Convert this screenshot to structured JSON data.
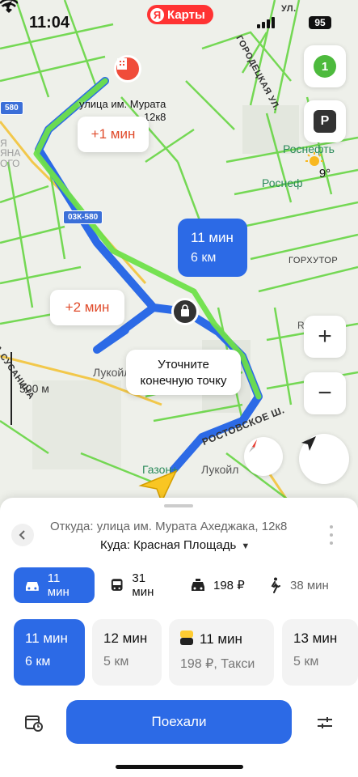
{
  "status": {
    "time": "11:04",
    "app_badge": "Карты",
    "brand_letter": "Я",
    "battery": "95"
  },
  "map": {
    "labels": {
      "street_top": "ГОРОДЕЦКАЯ УЛ.",
      "street_top2": "УЛ.",
      "rosneft1": "Роснефть",
      "rosneft2": "Роснеф",
      "gorkhutor": "ГОРХУТОР",
      "rostovskoe": "РОСТОВСКОЕ Ш.",
      "route_code": "03К-580",
      "lukoil1": "Лукойл",
      "lukoil2": "Лукойл",
      "gazon": "Газон+",
      "susanina": "А СУСАНИНА",
      "left_code": "580",
      "left_yana": "ЯНА",
      "left_ogo": "ОГО",
      "left_ya": "Я",
      "rus": "Rus",
      "scale": "500 м"
    },
    "start_label": {
      "line1": "улица им. Мурата",
      "line2": "12к8"
    },
    "alt_route_1": "+1 мин",
    "alt_route_2": "+2 мин",
    "main_route": {
      "time": "11 мин",
      "distance": "6 км"
    },
    "refine": {
      "line1": "Уточните",
      "line2": "конечную точку"
    },
    "controls": {
      "traffic_level": "1",
      "parking": "P",
      "weather": "9°",
      "zoom_in": "+",
      "zoom_out": "−"
    },
    "colors": {
      "route_blue": "#2c6ae6",
      "traffic_green": "#5fd43a",
      "accent_red": "#f33"
    }
  },
  "sheet": {
    "from": "Откуда: улица им. Мурата Ахеджака, 12к8",
    "to": "Куда: Красная Площадь",
    "modes": [
      {
        "icon": "car-icon",
        "label": "11 мин",
        "active": true
      },
      {
        "icon": "bus-icon",
        "label": "31 мин",
        "active": false
      },
      {
        "icon": "taxi-icon",
        "label": "198 ₽",
        "active": false
      },
      {
        "icon": "walk-icon",
        "label": "38 мин",
        "active": false
      }
    ],
    "options": [
      {
        "time": "11 мин",
        "detail": "6 км",
        "active": true
      },
      {
        "time": "12 мин",
        "detail": "5 км",
        "active": false
      },
      {
        "time": "11 мин",
        "detail": "198 ₽, Такси",
        "active": false
      },
      {
        "time": "13 мин",
        "detail": "5 км",
        "active": false
      }
    ],
    "go_button": "Поехали"
  }
}
